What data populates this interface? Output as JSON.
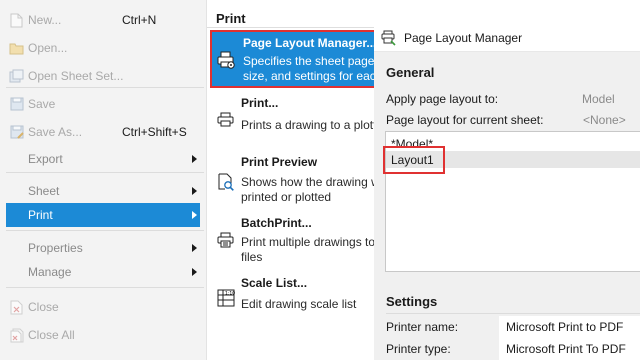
{
  "app_menu": {
    "items": [
      {
        "key": "new",
        "label": "New...",
        "shortcut": "Ctrl+N",
        "icon": "new-document-icon"
      },
      {
        "key": "open",
        "label": "Open...",
        "icon": "open-folder-icon"
      },
      {
        "key": "open-sheet-set",
        "label": "Open Sheet Set...",
        "icon": "sheet-set-icon"
      },
      {
        "key": "save",
        "label": "Save",
        "icon": "save-icon"
      },
      {
        "key": "save-as",
        "label": "Save As...",
        "shortcut": "Ctrl+Shift+S",
        "icon": "save-as-icon"
      },
      {
        "key": "export",
        "label": "Export"
      },
      {
        "key": "sheet",
        "label": "Sheet"
      },
      {
        "key": "print",
        "label": "Print"
      },
      {
        "key": "properties",
        "label": "Properties"
      },
      {
        "key": "manage",
        "label": "Manage"
      },
      {
        "key": "close",
        "label": "Close",
        "icon": "close-document-icon"
      },
      {
        "key": "close-all",
        "label": "Close All",
        "icon": "close-all-icon"
      }
    ]
  },
  "print_submenu": {
    "header": "Print",
    "items": [
      {
        "key": "page-layout-manager",
        "title": "Page Layout Manager...",
        "desc_lines": [
          "Specifies the sheet page,",
          "size, and settings for each"
        ],
        "icon": "page-layout-printer-icon"
      },
      {
        "key": "print",
        "title": "Print...",
        "desc_lines": [
          "Prints a drawing to a plott"
        ],
        "icon": "printer-icon"
      },
      {
        "key": "print-preview",
        "title": "Print Preview",
        "desc_lines": [
          "Shows how the drawing will",
          "printed or plotted"
        ],
        "icon": "print-preview-icon"
      },
      {
        "key": "batch-print",
        "title": "BatchPrint...",
        "desc_lines": [
          "Print multiple drawings to",
          "files"
        ],
        "icon": "batch-print-icon"
      },
      {
        "key": "scale-list",
        "title": "Scale List...",
        "desc_lines": [
          "Edit drawing scale list"
        ],
        "icon": "scale-list-icon"
      }
    ]
  },
  "page_layout_manager": {
    "title": "Page Layout Manager",
    "general_header": "General",
    "apply_label": "Apply page layout to:",
    "apply_value": "Model",
    "current_label": "Page layout for current sheet:",
    "current_value": "<None>",
    "layouts": [
      "*Model*",
      "Layout1"
    ],
    "settings_header": "Settings",
    "printer_name_label": "Printer name:",
    "printer_name_value": "Microsoft Print to PDF",
    "printer_type_label": "Printer type:",
    "printer_type_value": "Microsoft Print To PDF"
  },
  "colors": {
    "highlight": "#1c8ad6",
    "callout": "#e03131"
  }
}
